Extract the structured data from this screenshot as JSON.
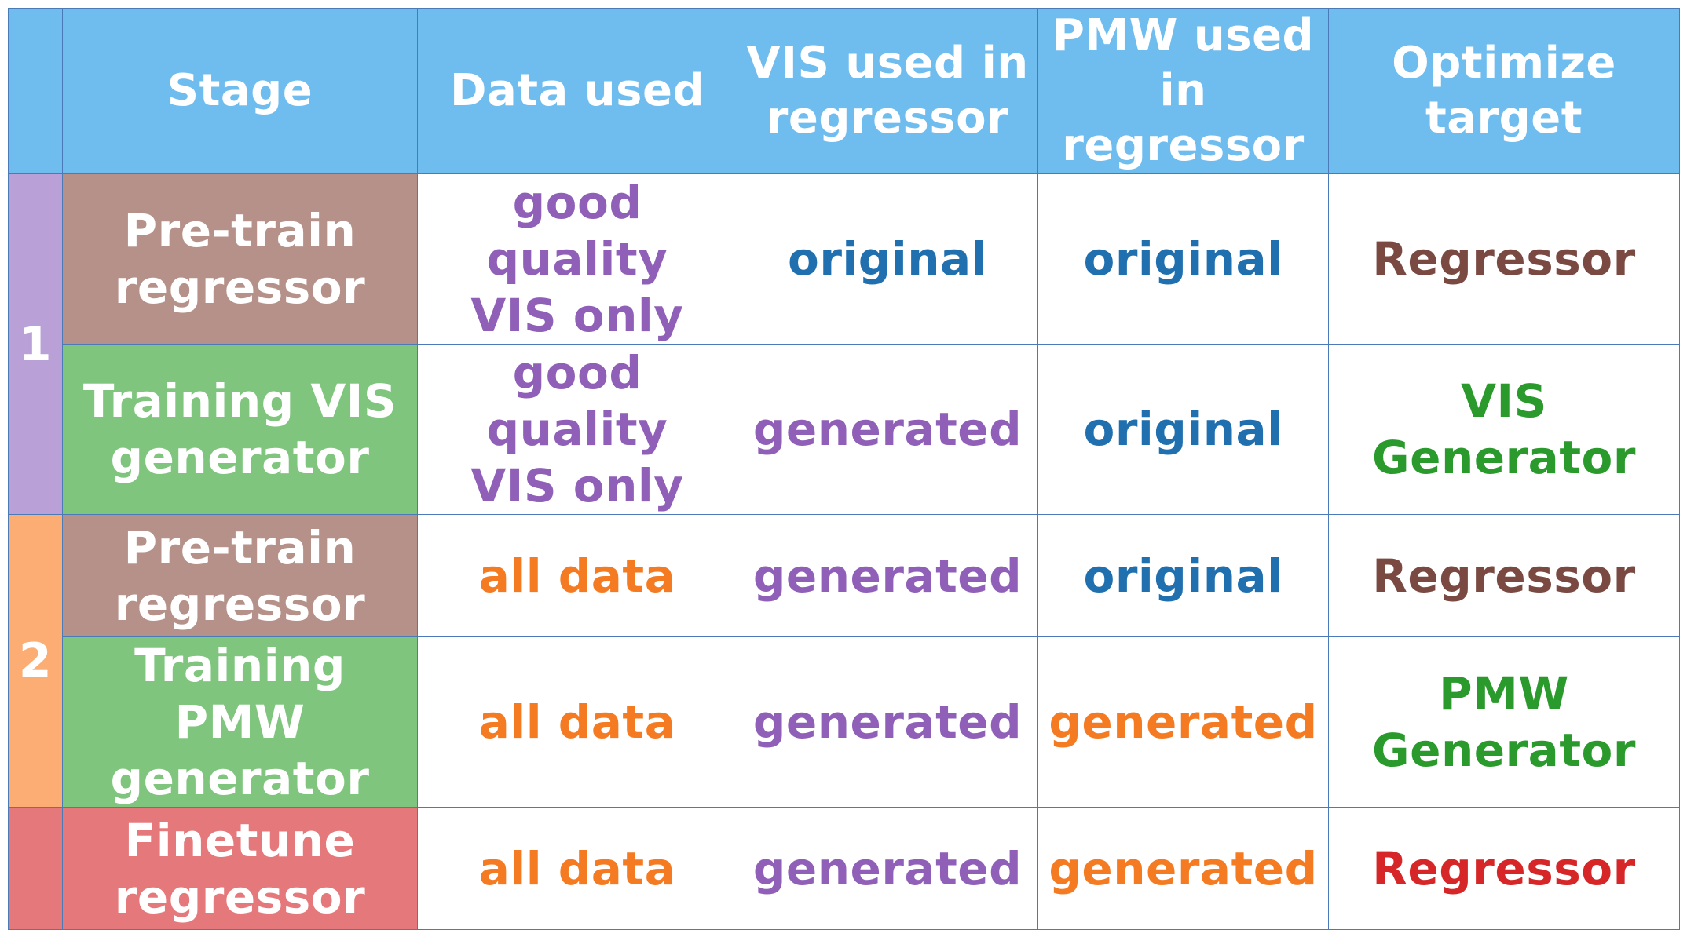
{
  "header": {
    "group": "",
    "stage": "Stage",
    "data_used": "Data used",
    "vis_line1": "VIS used in",
    "vis_line2": "regressor",
    "pmw_line1": "PMW used in",
    "pmw_line2": "regressor",
    "optimize": "Optimize target"
  },
  "groups": [
    {
      "label": "1"
    },
    {
      "label": "2"
    },
    {
      "label": ""
    }
  ],
  "rows": [
    {
      "stage_line1": "Pre-train",
      "stage_line2": "regressor",
      "data_line1": "good quality",
      "data_line2": "VIS only",
      "vis": "original",
      "pmw": "original",
      "target": "Regressor"
    },
    {
      "stage_line1": "Training VIS",
      "stage_line2": "generator",
      "data_line1": "good quality",
      "data_line2": "VIS only",
      "vis": "generated",
      "pmw": "original",
      "target": "VIS Generator"
    },
    {
      "stage_line1": "Pre-train",
      "stage_line2": "regressor",
      "data_line1": "all data",
      "data_line2": "",
      "vis": "generated",
      "pmw": "original",
      "target": "Regressor"
    },
    {
      "stage_line1": "Training PMW",
      "stage_line2": "generator",
      "data_line1": "all data",
      "data_line2": "",
      "vis": "generated",
      "pmw": "generated",
      "target": "PMW Generator"
    },
    {
      "stage_line1": "Finetune",
      "stage_line2": "regressor",
      "data_line1": "all data",
      "data_line2": "",
      "vis": "generated",
      "pmw": "generated",
      "target": "Regressor"
    }
  ],
  "colors": {
    "header_bg": "#6fbcef",
    "group1_bg": "#b9a1d8",
    "group2_bg": "#fcad73",
    "group3_bg": "#e5787b",
    "pretrain_bg": "#b59189",
    "training_bg": "#7fc57e",
    "finetune_bg": "#e5787b",
    "purple_text": "#9060b8",
    "blue_text": "#2070b0",
    "orange_text": "#f57b22",
    "brown_text": "#7a4a42",
    "green_text": "#2a9a2c",
    "red_text": "#d62627"
  }
}
